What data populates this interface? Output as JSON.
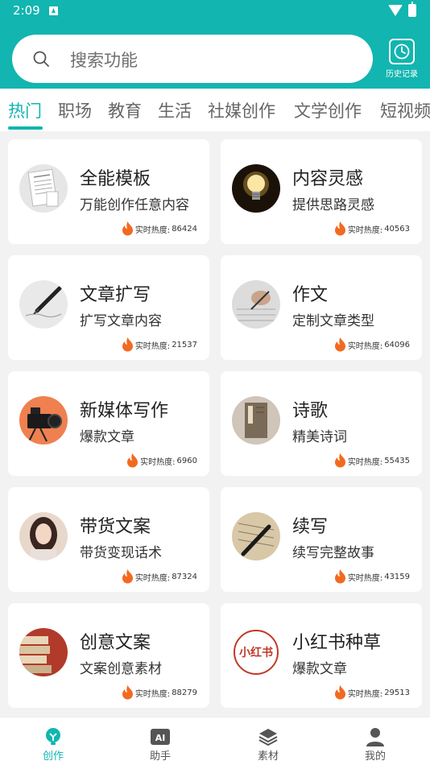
{
  "status_bar": {
    "time": "2:09"
  },
  "search": {
    "placeholder": "搜索功能"
  },
  "history": {
    "label": "历史记录"
  },
  "tabs": [
    "热门",
    "职场",
    "教育",
    "生活",
    "社媒创作",
    "文学创作",
    "短视频"
  ],
  "heat_prefix": "实时热度:",
  "cards": [
    {
      "title": "全能模板",
      "subtitle": "万能创作任意内容",
      "heat": "86424"
    },
    {
      "title": "内容灵感",
      "subtitle": "提供思路灵感",
      "heat": "40563"
    },
    {
      "title": "文章扩写",
      "subtitle": "扩写文章内容",
      "heat": "21537"
    },
    {
      "title": "作文",
      "subtitle": "定制文章类型",
      "heat": "64096"
    },
    {
      "title": "新媒体写作",
      "subtitle": "爆款文章",
      "heat": "6960"
    },
    {
      "title": "诗歌",
      "subtitle": "精美诗词",
      "heat": "55435"
    },
    {
      "title": "带货文案",
      "subtitle": "带货变现话术",
      "heat": "87324"
    },
    {
      "title": "续写",
      "subtitle": "续写完整故事",
      "heat": "43159"
    },
    {
      "title": "创意文案",
      "subtitle": "文案创意素材",
      "heat": "88279"
    },
    {
      "title": "小红书种草",
      "subtitle": "爆款文章",
      "heat": "29513"
    }
  ],
  "xhs_logo_text": "小红书",
  "bottom_nav": [
    {
      "label": "创作",
      "icon": "bulb-icon",
      "active": true
    },
    {
      "label": "助手",
      "icon": "ai-icon",
      "active": false
    },
    {
      "label": "素材",
      "icon": "layers-icon",
      "active": false
    },
    {
      "label": "我的",
      "icon": "user-icon",
      "active": false
    }
  ],
  "ai_badge_text": "AI",
  "colors": {
    "accent": "#12b5b0",
    "flame": "#f26a21"
  }
}
